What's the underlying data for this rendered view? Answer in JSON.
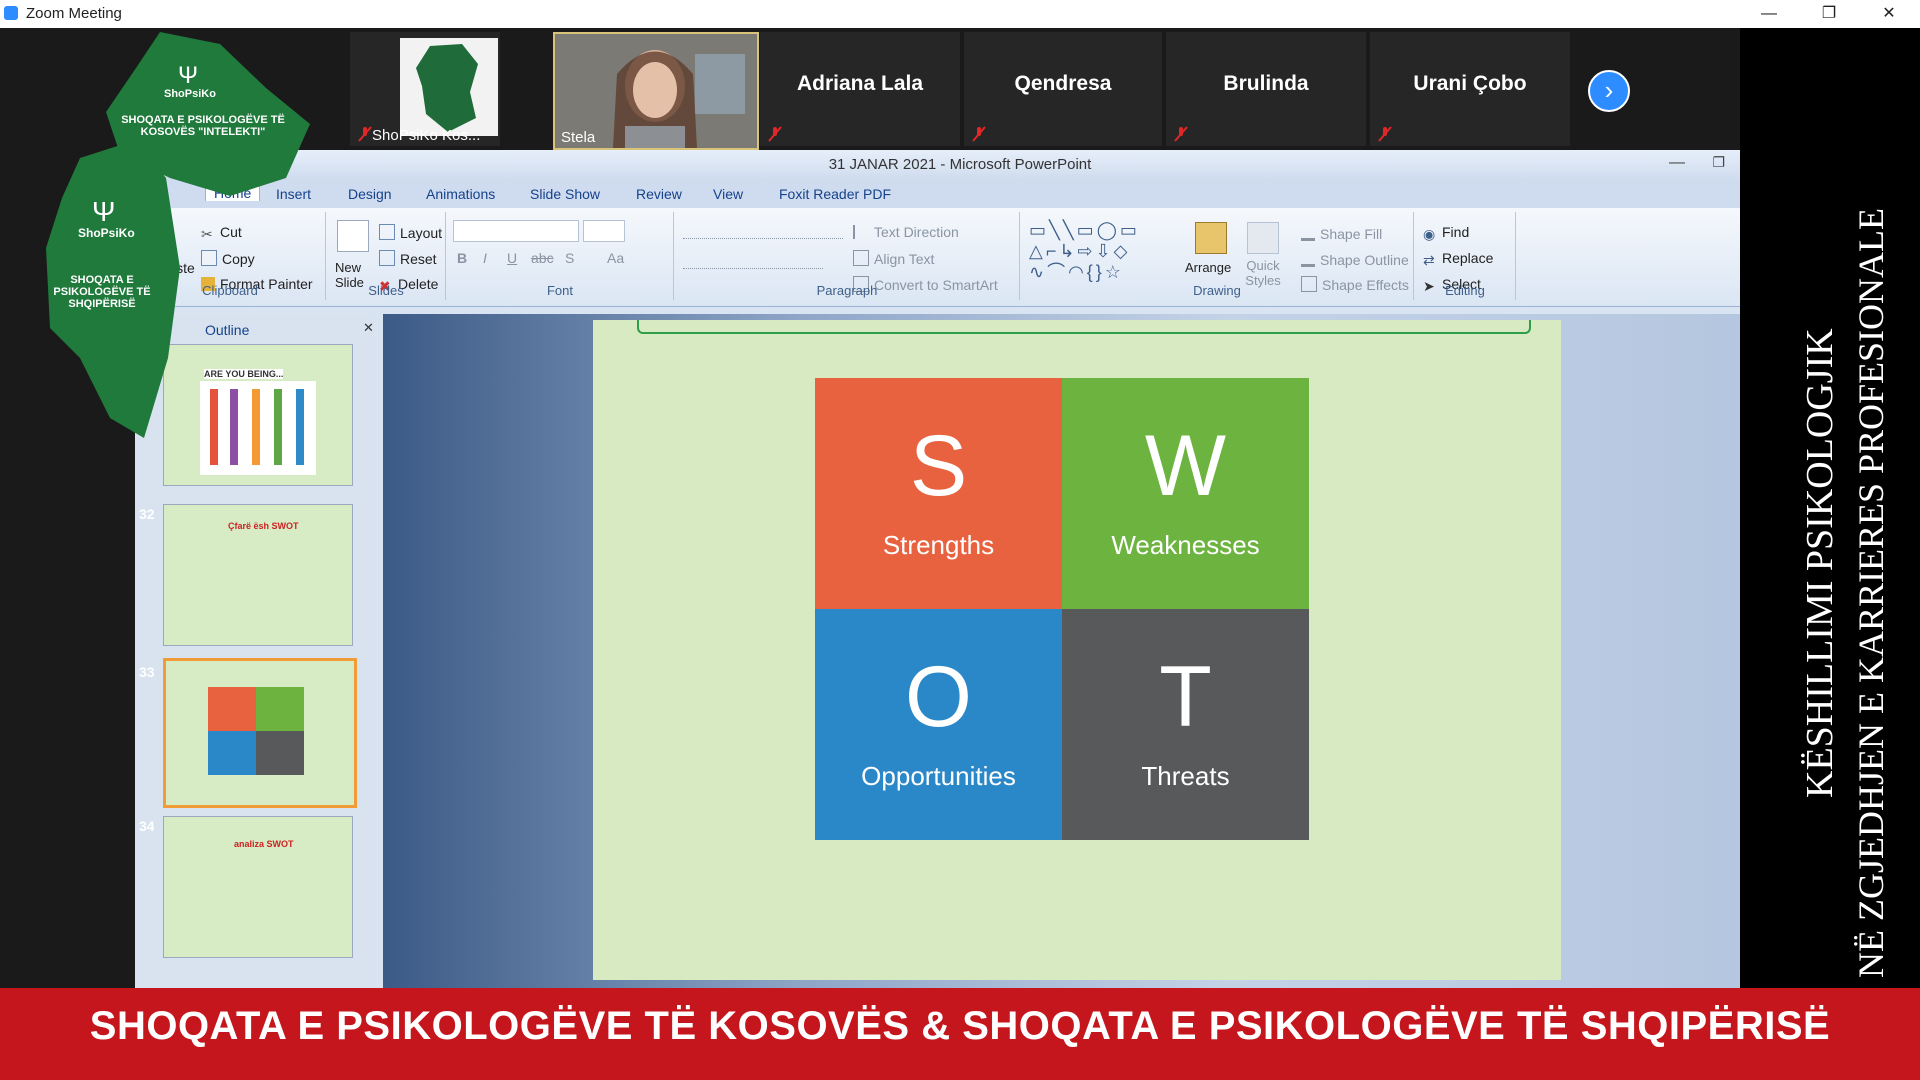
{
  "window": {
    "title": "Zoom Meeting"
  },
  "participants": [
    {
      "name": "ShoPsiKo Kos...",
      "muted": true
    },
    {
      "name": "Stela",
      "muted": true
    },
    {
      "name": "Adriana Lala",
      "muted": true
    },
    {
      "name": "Qendresa",
      "muted": true
    },
    {
      "name": "Brulinda",
      "muted": true
    },
    {
      "name": "Urani Çobo",
      "muted": true
    }
  ],
  "logo": {
    "top_name": "ShoPsiKo",
    "top_text": "SHOQATA E PSIKOLOGËVE TË KOSOVËS \"INTELEKTI\"",
    "bottom_name": "ShoPsiKo",
    "bottom_text": "SHOQATA E PSIKOLOGËVE TË SHQIPËRISË"
  },
  "vertical_banner": {
    "line1": "KËSHILLIMI PSIKOLOGJIK",
    "line2": "NË ZGJEDHJEN E KARRIERES PROFESIONALE"
  },
  "powerpoint": {
    "title": "31 JANAR 2021 - Microsoft PowerPoint",
    "tabs": [
      "Home",
      "Insert",
      "Design",
      "Animations",
      "Slide Show",
      "Review",
      "View",
      "Foxit Reader PDF"
    ],
    "ribbon": {
      "clipboard": {
        "label": "Clipboard",
        "paste": "Paste",
        "cut": "Cut",
        "copy": "Copy",
        "format_painter": "Format Painter"
      },
      "slides": {
        "label": "Slides",
        "new_slide": "New Slide",
        "layout": "Layout",
        "reset": "Reset",
        "delete": "Delete"
      },
      "font": {
        "label": "Font"
      },
      "paragraph": {
        "label": "Paragraph",
        "text_direction": "Text Direction",
        "align_text": "Align Text",
        "convert": "Convert to SmartArt"
      },
      "drawing": {
        "label": "Drawing",
        "arrange": "Arrange",
        "quick_styles": "Quick Styles",
        "shape_fill": "Shape Fill",
        "shape_outline": "Shape Outline",
        "shape_effects": "Shape Effects"
      },
      "editing": {
        "label": "Editing",
        "find": "Find",
        "replace": "Replace",
        "select": "Select"
      }
    },
    "panel": {
      "tab": "Outline",
      "thumbnails": [
        {
          "number": "",
          "title": "ARE YOU BEING..."
        },
        {
          "number": "32",
          "title": "Çfarë ësh SWOT"
        },
        {
          "number": "33",
          "title": ""
        },
        {
          "number": "34",
          "title": "analiza SWOT"
        }
      ]
    },
    "slide": {
      "swot": [
        {
          "letter": "S",
          "word": "Strengths",
          "color": "#e8623f"
        },
        {
          "letter": "W",
          "word": "Weaknesses",
          "color": "#6cb33f"
        },
        {
          "letter": "O",
          "word": "Opportunities",
          "color": "#2b88c8"
        },
        {
          "letter": "T",
          "word": "Threats",
          "color": "#58595b"
        }
      ]
    }
  },
  "bottom_banner": {
    "text": "SHOQATA E PSIKOLOGËVE TË KOSOVËS  & SHOQATA E PSIKOLOGËVE TË SHQIPËRISË"
  }
}
